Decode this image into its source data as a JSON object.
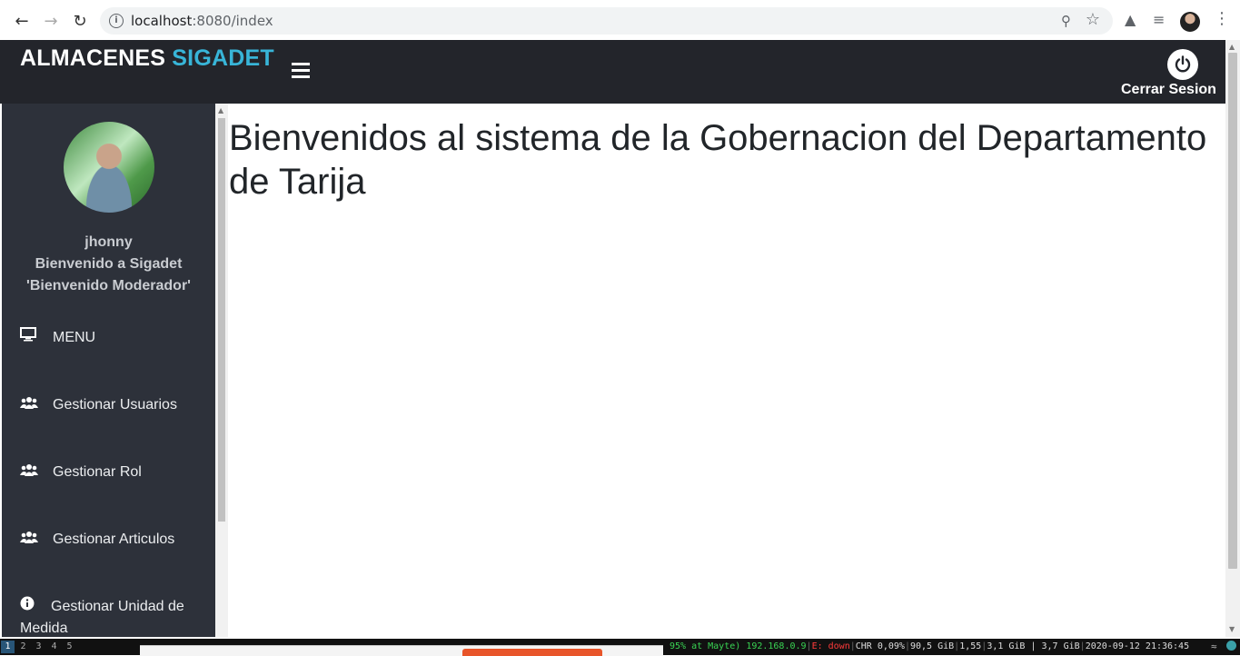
{
  "browser": {
    "url_host": "localhost",
    "url_rest": ":8080/index"
  },
  "header": {
    "brand_main": "ALMACENES",
    "brand_accent": "SIGADET",
    "logout_label": "Cerrar Sesion",
    "colors": {
      "bar": "#23252b",
      "accent": "#38b5d8"
    }
  },
  "sidebar": {
    "username": "jhonny",
    "greeting": "Bienvenido a Sigadet",
    "role_msg": "'Bienvenido Moderador'",
    "items": [
      {
        "label": "MENU",
        "icon": "monitor-icon"
      },
      {
        "label": "Gestionar Usuarios",
        "icon": "users-icon"
      },
      {
        "label": "Gestionar Rol",
        "icon": "users-icon"
      },
      {
        "label": "Gestionar Articulos",
        "icon": "users-icon"
      },
      {
        "label": "Gestionar Unidad de Medida",
        "icon": "info-circle-icon"
      }
    ]
  },
  "main": {
    "welcome": "Bienvenidos al sistema de la Gobernacion del Departamento de Tarija"
  },
  "taskbar": {
    "workspaces": [
      "1",
      "2",
      "3",
      "4",
      "5"
    ],
    "battery": "95% at Mayte)",
    "ip": "192.168.0.9",
    "eth": "E: down",
    "cpu": "CHR 0,09%",
    "disk": "90,5 GiB",
    "load": "1,55",
    "mem": "3,1 GiB | 3,7 GiB",
    "datetime": "2020-09-12 21:36:45"
  }
}
